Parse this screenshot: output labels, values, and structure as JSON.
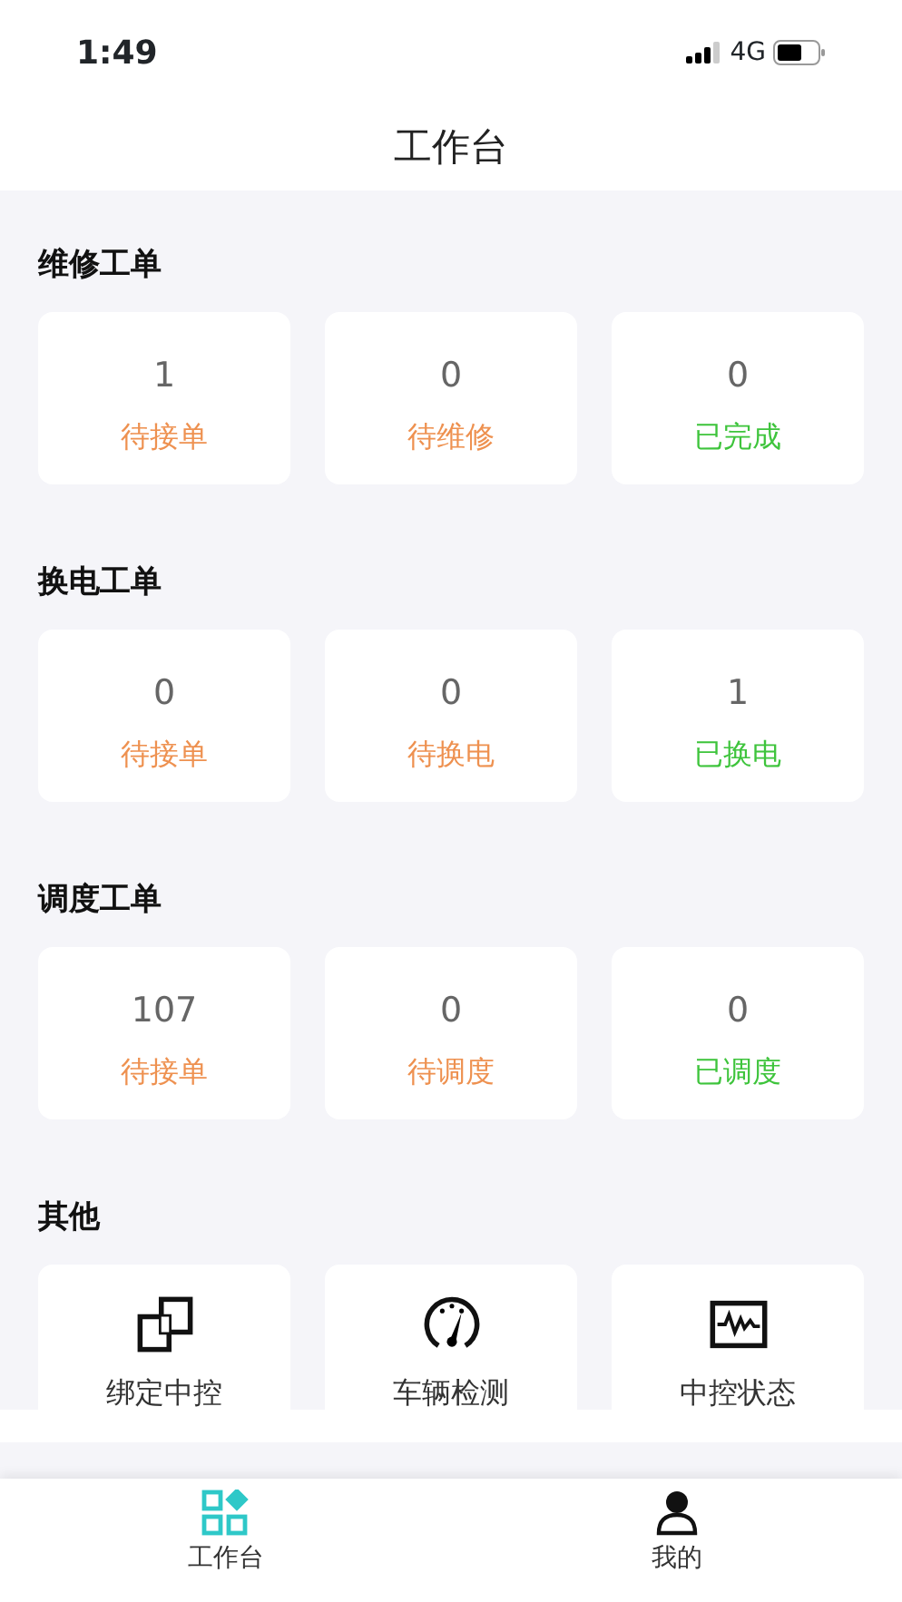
{
  "status_bar": {
    "time": "1:49",
    "network": "4G"
  },
  "header": {
    "title": "工作台"
  },
  "sections": [
    {
      "title": "维修工单",
      "stats": [
        {
          "value": "1",
          "label": "待接单",
          "kind": "pending"
        },
        {
          "value": "0",
          "label": "待维修",
          "kind": "pending"
        },
        {
          "value": "0",
          "label": "已完成",
          "kind": "done"
        }
      ]
    },
    {
      "title": "换电工单",
      "stats": [
        {
          "value": "0",
          "label": "待接单",
          "kind": "pending"
        },
        {
          "value": "0",
          "label": "待换电",
          "kind": "pending"
        },
        {
          "value": "1",
          "label": "已换电",
          "kind": "done"
        }
      ]
    },
    {
      "title": "调度工单",
      "stats": [
        {
          "value": "107",
          "label": "待接单",
          "kind": "pending"
        },
        {
          "value": "0",
          "label": "待调度",
          "kind": "pending"
        },
        {
          "value": "0",
          "label": "已调度",
          "kind": "done"
        }
      ]
    }
  ],
  "other": {
    "title": "其他",
    "tools": [
      {
        "label": "绑定中控",
        "kind": "bind"
      },
      {
        "label": "车辆检测",
        "kind": "gauge"
      },
      {
        "label": "中控状态",
        "kind": "monitor"
      }
    ]
  },
  "tab_bar": [
    {
      "label": "工作台",
      "kind": "grid",
      "selected": true
    },
    {
      "label": "我的",
      "kind": "person",
      "selected": false
    }
  ]
}
